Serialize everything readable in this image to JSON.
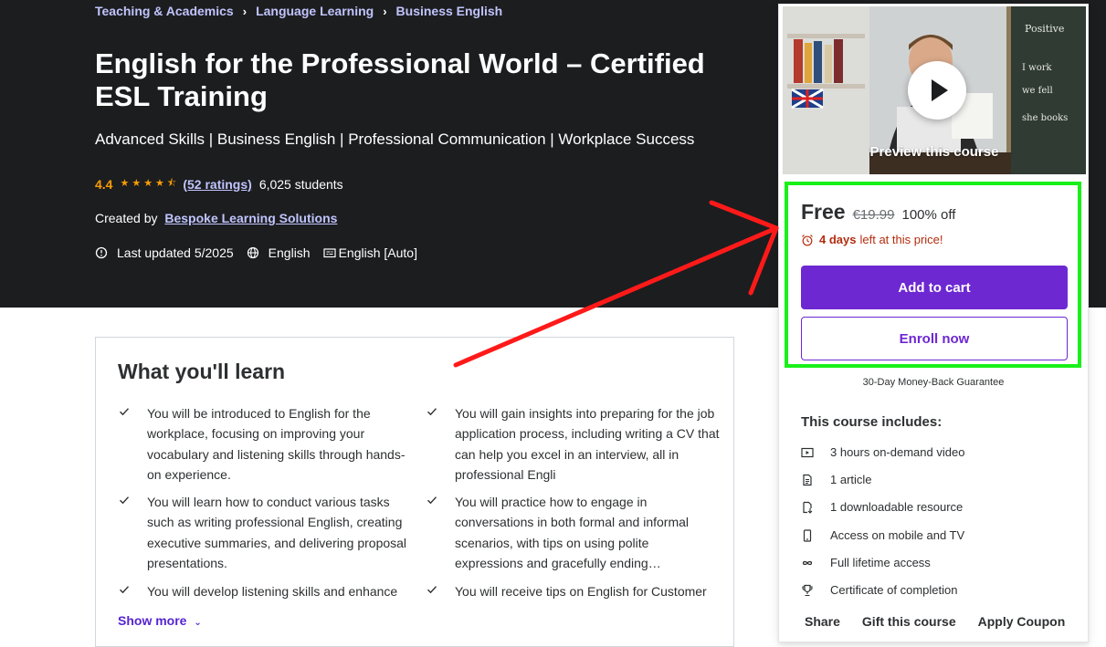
{
  "breadcrumb": [
    "Teaching & Academics",
    "Language Learning",
    "Business English"
  ],
  "course": {
    "title": "English for the Professional World – Certified ESL Training",
    "subtitle": "Advanced Skills | Business English | Professional Communication | Workplace Success",
    "rating": "4.4",
    "ratings_count": "(52 ratings)",
    "students": "6,025 students",
    "created_by_label": "Created by",
    "creator": "Bespoke Learning Solutions",
    "last_updated": "Last updated 5/2025",
    "language": "English",
    "captions": "English [Auto]"
  },
  "learn": {
    "title": "What you'll learn",
    "items": [
      "You will be introduced to English for the workplace, focusing on improving your vocabulary and listening skills through hands-on experience.",
      "You will gain insights into preparing for the job application process, including writing a CV that can help you excel in an interview, all in professional Engli",
      "You will learn how to conduct various tasks such as writing professional English, creating executive summaries, and delivering proposal presentations.",
      "You will practice how to engage in conversations in both formal and informal scenarios, with tips on using polite expressions and gracefully ending…",
      "You will develop listening skills and enhance",
      "You will receive tips on English for Customer"
    ],
    "show_more": "Show more"
  },
  "sidebar": {
    "preview_label": "Preview this course",
    "price": "Free",
    "original_price": "€19.99",
    "discount": "100% off",
    "timer_bold": "4 days",
    "timer_rest": "left at this price!",
    "add_to_cart": "Add to cart",
    "enroll_now": "Enroll now",
    "guarantee": "30-Day Money-Back Guarantee",
    "includes_title": "This course includes:",
    "includes": [
      {
        "icon": "video-icon",
        "label": "3 hours on-demand video"
      },
      {
        "icon": "article-icon",
        "label": "1 article"
      },
      {
        "icon": "download-icon",
        "label": "1 downloadable resource"
      },
      {
        "icon": "mobile-icon",
        "label": "Access on mobile and TV"
      },
      {
        "icon": "infinity-icon",
        "label": "Full lifetime access"
      },
      {
        "icon": "trophy-icon",
        "label": "Certificate of completion"
      }
    ],
    "footer": [
      "Share",
      "Gift this course",
      "Apply Coupon"
    ]
  },
  "colors": {
    "hero_bg": "#1c1d1f",
    "accent_purple": "#6d28d2",
    "link_lavender": "#c0c4fc",
    "star_orange": "#f69c08",
    "annotation_red": "#ff1a1a",
    "annotation_green": "#19f019"
  }
}
